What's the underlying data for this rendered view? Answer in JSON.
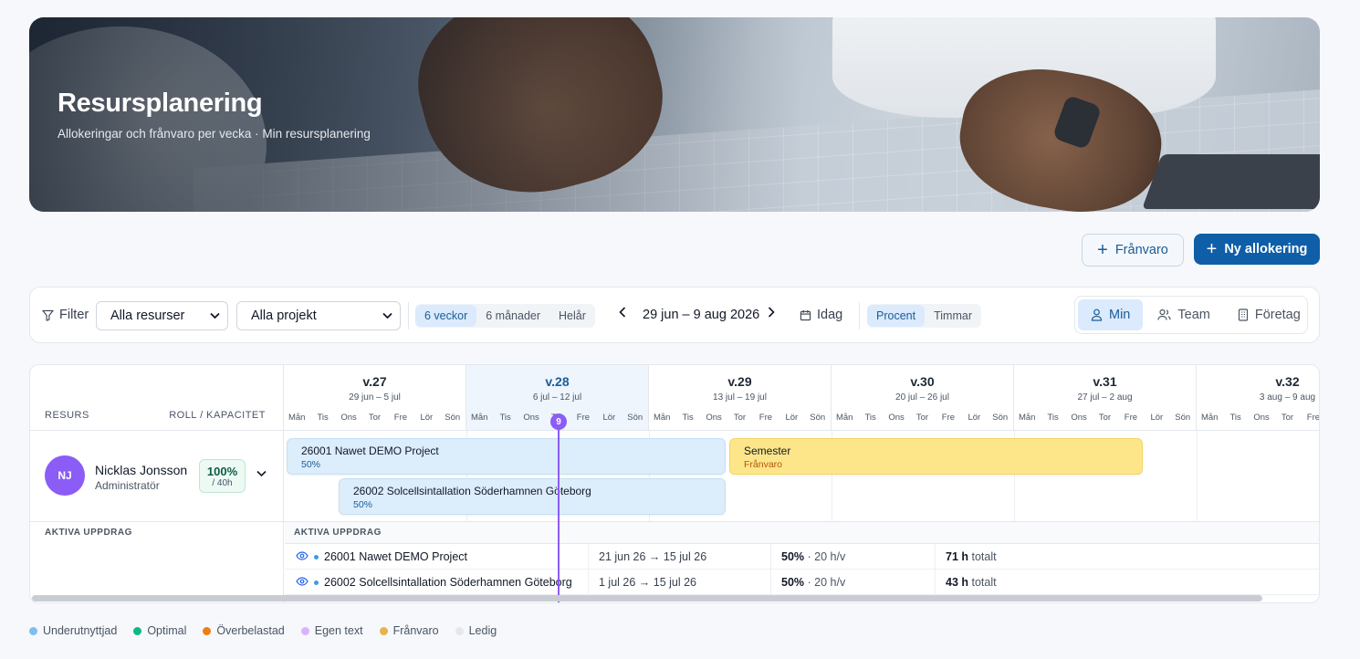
{
  "hero": {
    "title": "Resursplanering",
    "subtitle": "Allokeringar och frånvaro per vecka · Min resursplanering"
  },
  "actions": {
    "absence_label": "Frånvaro",
    "new_allocation_label": "Ny allokering"
  },
  "toolbar": {
    "filter_label": "Filter",
    "resource_select": "Alla resurser",
    "project_select": "Alla projekt",
    "period_options": [
      "6 veckor",
      "6 månader",
      "Helår"
    ],
    "period_selected": "6 veckor",
    "date_range": "29 jun – 9 aug 2026",
    "today_label": "Idag",
    "unit_options": [
      "Procent",
      "Timmar"
    ],
    "unit_selected": "Procent",
    "scope_options": [
      "Min",
      "Team",
      "Företag"
    ],
    "scope_selected": "Min"
  },
  "grid": {
    "resource_header": "RESURS",
    "role_header": "ROLL / KAPACITET",
    "weeks": [
      {
        "label": "v.27",
        "range": "29 jun – 5 jul",
        "current": false
      },
      {
        "label": "v.28",
        "range": "6 jul – 12 jul",
        "current": true
      },
      {
        "label": "v.29",
        "range": "13 jul – 19 jul",
        "current": false
      },
      {
        "label": "v.30",
        "range": "20 jul – 26 jul",
        "current": false
      },
      {
        "label": "v.31",
        "range": "27 jul – 2 aug",
        "current": false
      },
      {
        "label": "v.32",
        "range": "3 aug – 9 aug",
        "current": false
      }
    ],
    "day_names": [
      "Mån",
      "Tis",
      "Ons",
      "Tor",
      "Fre",
      "Lör",
      "Sön"
    ],
    "today_marker": "9",
    "resource": {
      "initials": "NJ",
      "name": "Nicklas Jonsson",
      "role": "Administratör",
      "capacity_pct": "100%",
      "capacity_hours": "/ 40h"
    },
    "bars": [
      {
        "title": "26001 Nawet DEMO Project",
        "sub": "50%",
        "type": "allocation"
      },
      {
        "title": "Semester",
        "sub": "Frånvaro",
        "type": "absence"
      },
      {
        "title": "26002 Solcellsintallation Söderhamnen Göteborg",
        "sub": "50%",
        "type": "allocation"
      }
    ],
    "active_header_left": "AKTIVA UPPDRAG",
    "active_header_right": "AKTIVA UPPDRAG",
    "assignments": [
      {
        "name": "26001 Nawet DEMO Project",
        "dates": "21 jun 26 → 15 jul 26",
        "pct": "50%",
        "rate": "· 20 h/v",
        "total_h": "71 h",
        "total_label": "totalt"
      },
      {
        "name": "26002 Solcellsintallation Söderhamnen Göteborg",
        "dates": "1 jul 26 → 15 jul 26",
        "pct": "50%",
        "rate": "· 20 h/v",
        "total_h": "43 h",
        "total_label": "totalt"
      }
    ]
  },
  "legend": [
    {
      "label": "Underutnyttjad",
      "color": "#7cc0f2"
    },
    {
      "label": "Optimal",
      "color": "#10b981"
    },
    {
      "label": "Överbelastad",
      "color": "#f07d12"
    },
    {
      "label": "Egen text",
      "color": "#d8b4fe"
    },
    {
      "label": "Frånvaro",
      "color": "#e8b34a"
    },
    {
      "label": "Ledig",
      "color": "#e5e7eb"
    }
  ]
}
